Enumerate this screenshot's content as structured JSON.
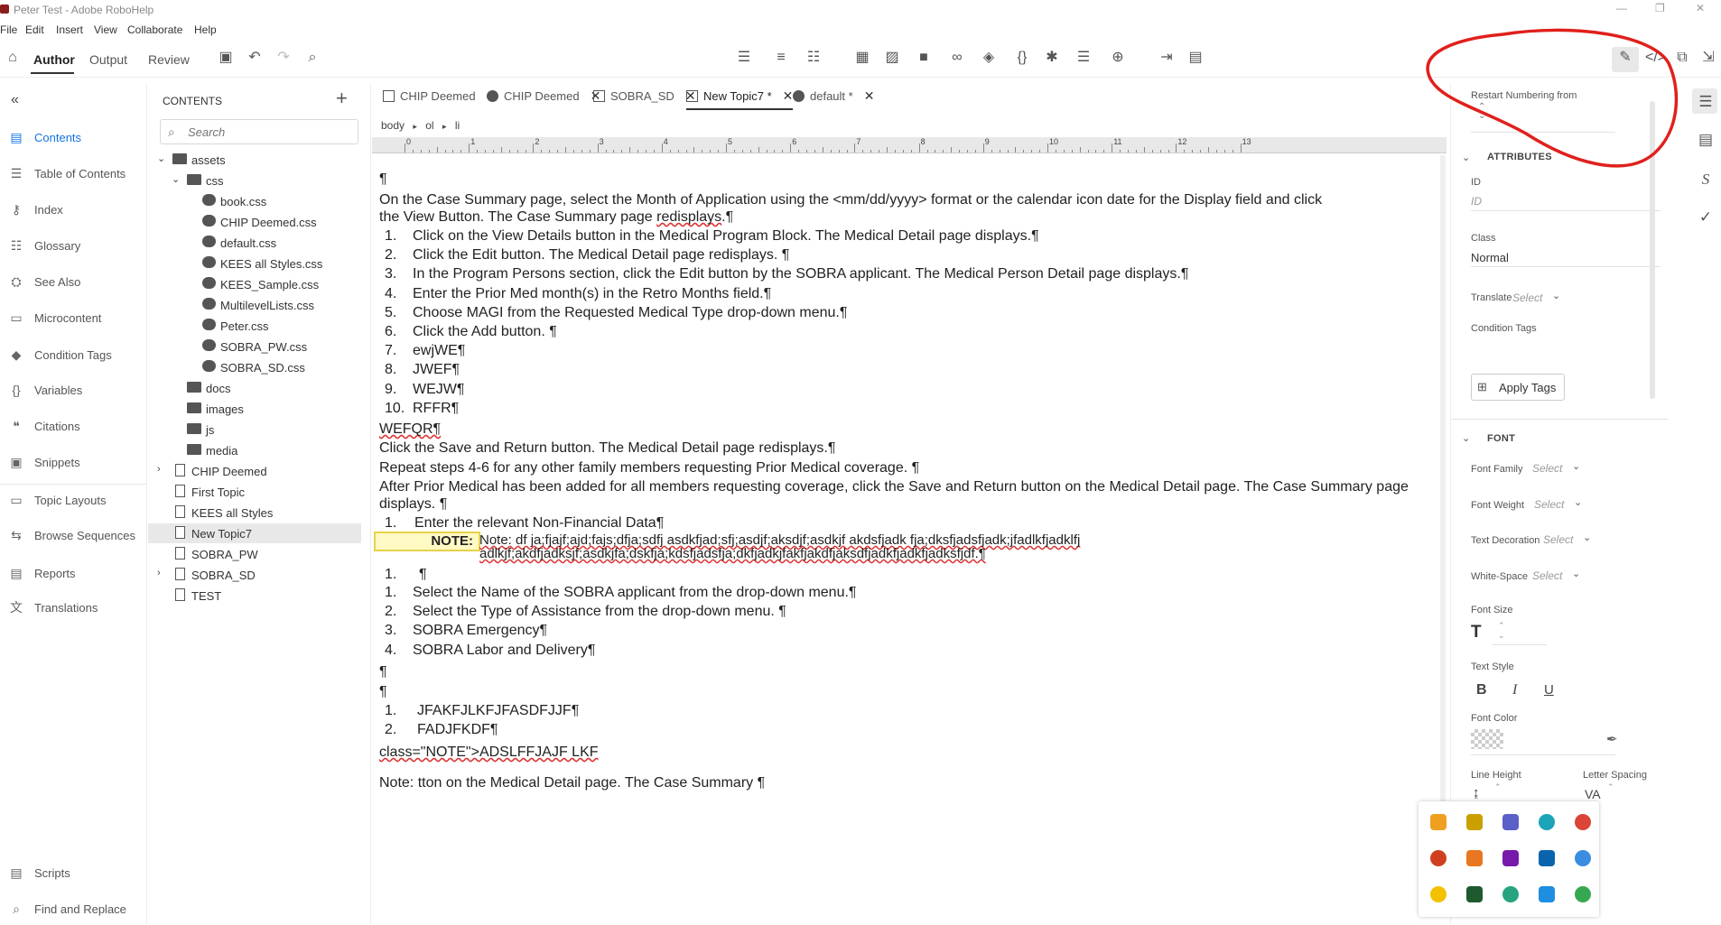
{
  "window": {
    "title": "Peter Test - Adobe RoboHelp",
    "minimize": "—",
    "maximize": "❐",
    "close": "✕"
  },
  "menu": [
    "File",
    "Edit",
    "Insert",
    "View",
    "Collaborate",
    "Help"
  ],
  "modes": [
    "Author",
    "Output",
    "Review"
  ],
  "nav": {
    "items": [
      "Contents",
      "Table of Contents",
      "Index",
      "Glossary",
      "See Also",
      "Microcontent",
      "Condition Tags",
      "Variables",
      "Citations",
      "Snippets",
      "Topic Layouts",
      "Browse Sequences",
      "Reports",
      "Translations"
    ],
    "bottom": [
      "Scripts",
      "Find and Replace"
    ],
    "active": "Contents"
  },
  "contents": {
    "title": "CONTENTS",
    "search_placeholder": "Search",
    "tree": [
      {
        "label": "assets",
        "type": "folder",
        "level": 0,
        "expanded": true
      },
      {
        "label": "css",
        "type": "folder",
        "level": 1,
        "expanded": true
      },
      {
        "label": "book.css",
        "type": "css",
        "level": 2
      },
      {
        "label": "CHIP Deemed.css",
        "type": "css",
        "level": 2
      },
      {
        "label": "default.css",
        "type": "css",
        "level": 2
      },
      {
        "label": "KEES all Styles.css",
        "type": "css",
        "level": 2
      },
      {
        "label": "KEES_Sample.css",
        "type": "css",
        "level": 2
      },
      {
        "label": "MultilevelLists.css",
        "type": "css",
        "level": 2
      },
      {
        "label": "Peter.css",
        "type": "css",
        "level": 2
      },
      {
        "label": "SOBRA_PW.css",
        "type": "css",
        "level": 2
      },
      {
        "label": "SOBRA_SD.css",
        "type": "css",
        "level": 2
      },
      {
        "label": "docs",
        "type": "folder",
        "level": 1
      },
      {
        "label": "images",
        "type": "folder",
        "level": 1
      },
      {
        "label": "js",
        "type": "folder",
        "level": 1
      },
      {
        "label": "media",
        "type": "folder",
        "level": 1
      },
      {
        "label": "CHIP Deemed",
        "type": "file",
        "level": 0,
        "collapsed": true
      },
      {
        "label": "First Topic",
        "type": "file",
        "level": 0
      },
      {
        "label": "KEES all Styles",
        "type": "file",
        "level": 0
      },
      {
        "label": "New Topic7",
        "type": "file",
        "level": 0,
        "selected": true
      },
      {
        "label": "SOBRA_PW",
        "type": "file",
        "level": 0
      },
      {
        "label": "SOBRA_SD",
        "type": "file",
        "level": 0,
        "collapsed": true
      },
      {
        "label": "TEST",
        "type": "file",
        "level": 0
      }
    ]
  },
  "tabs": [
    {
      "label": "CHIP Deemed",
      "icon": "file"
    },
    {
      "label": "CHIP Deemed",
      "icon": "css"
    },
    {
      "label": "SOBRA_SD",
      "icon": "file"
    },
    {
      "label": "New Topic7 *",
      "icon": "file",
      "active": true
    },
    {
      "label": "default *",
      "icon": "css"
    }
  ],
  "breadcrumb": [
    "body",
    "ol",
    "li"
  ],
  "ruler": [
    "0",
    "1",
    "2",
    "3",
    "4",
    "5",
    "6",
    "7",
    "8",
    "9",
    "10",
    "11",
    "12",
    "13"
  ],
  "doc": {
    "pilcrow": "¶",
    "intro1": "On the Case Summary page, select the Month of Application using the <mm/dd/yyyy> format or the calendar icon date for the Display field and click",
    "intro2a": "the View Button.  The Case Summary page ",
    "intro2b": "redisplays",
    "intro2c": ".¶",
    "list1": [
      {
        "n": "1.",
        "t": "Click on the View Details button in the Medical Program Block.  The Medical Detail page displays.¶"
      },
      {
        "n": "2.",
        "t": "Click the Edit button. The Medical Detail page redisplays.  ¶"
      },
      {
        "n": "3.",
        "t": "In the Program Persons section, click the Edit button by the SOBRA applicant.  The Medical Person Detail page displays.¶"
      },
      {
        "n": "4.",
        "t": "Enter the Prior Med month(s) in the Retro Months field.¶"
      },
      {
        "n": "5.",
        "t": "Choose MAGI from the Requested Medical Type drop-down menu.¶"
      },
      {
        "n": "6.",
        "t": "Click the Add button.  ¶"
      },
      {
        "n": "7.",
        "t": "ewjWE¶"
      },
      {
        "n": "8.",
        "t": "JWEF¶"
      },
      {
        "n": "9.",
        "t": "WEJW¶"
      },
      {
        "n": "10.",
        "t": "RFFR¶"
      }
    ],
    "wefqr": "WEFQR¶",
    "save_line": "Click the Save and Return button.  The Medical Detail page redisplays.¶",
    "repeat_line": "Repeat steps 4-6 for any other family members requesting Prior Medical coverage.  ¶",
    "after1": "After Prior Medical has been added for all members requesting coverage, click the Save and Return button on the Medical Detail page. The Case Summary page",
    "after2": "displays.  ¶",
    "enter_item": {
      "n": "1.",
      "t": "Enter the relevant Non-Financial Data¶"
    },
    "note_label": "NOTE:",
    "note1": "Note:  df ja;fjajf;ajd;fajs;dfja;sdfj asdkfjad;sfj;asdjf;aksdjf;asdkjf akdsfjadk fja;dksfjadsfjadk;jfadlkfjadklfj",
    "note2": "adlkjf;akdfjadksjf;asdkjfa;dskfja;kdsfjadsfja;dkfjadkjfakfjakdfjaksdfjadkfjadkfjadksfjdf.¶",
    "empty_item": {
      "n": "1.",
      "t": "¶"
    },
    "list2": [
      {
        "n": "1.",
        "t": "Select the Name of the SOBRA applicant from  the drop-down menu.¶"
      },
      {
        "n": "2.",
        "t": "Select the Type of Assistance from the drop-down menu. ¶"
      },
      {
        "n": "3.",
        "t": "SOBRA Emergency¶"
      },
      {
        "n": "4.",
        "t": "SOBRA Labor and Delivery¶"
      }
    ],
    "list3": [
      {
        "n": "1.",
        "t": "JFAKFJLKFJFASDFJJF¶"
      },
      {
        "n": "2.",
        "t": "FADJFKDF¶"
      }
    ],
    "classline": "class=\"NOTE\">ADSLFFJAJF LKF",
    "lastline": "Note:  tton on the Medical Detail page. The Case Summary  ¶"
  },
  "props": {
    "restart_numbering": "Restart Numbering from",
    "attributes_head": "ATTRIBUTES",
    "id_label": "ID",
    "id_placeholder": "ID",
    "class_label": "Class",
    "class_value": "Normal",
    "translate_label": "Translate",
    "select": "Select",
    "condition_tags_label": "Condition Tags",
    "apply_tags": "Apply Tags",
    "font_head": "FONT",
    "font_family": "Font Family",
    "font_weight": "Font Weight",
    "text_decoration": "Text Decoration",
    "white_space": "White-Space",
    "font_size": "Font Size",
    "text_style": "Text Style",
    "bold": "B",
    "italic": "I",
    "underline": "U",
    "font_color": "Font Color",
    "line_height": "Line Height",
    "letter_spacing": "Letter Spacing",
    "va": "VA"
  },
  "annotation_color": "#e0201c",
  "accent": "#1473e6"
}
